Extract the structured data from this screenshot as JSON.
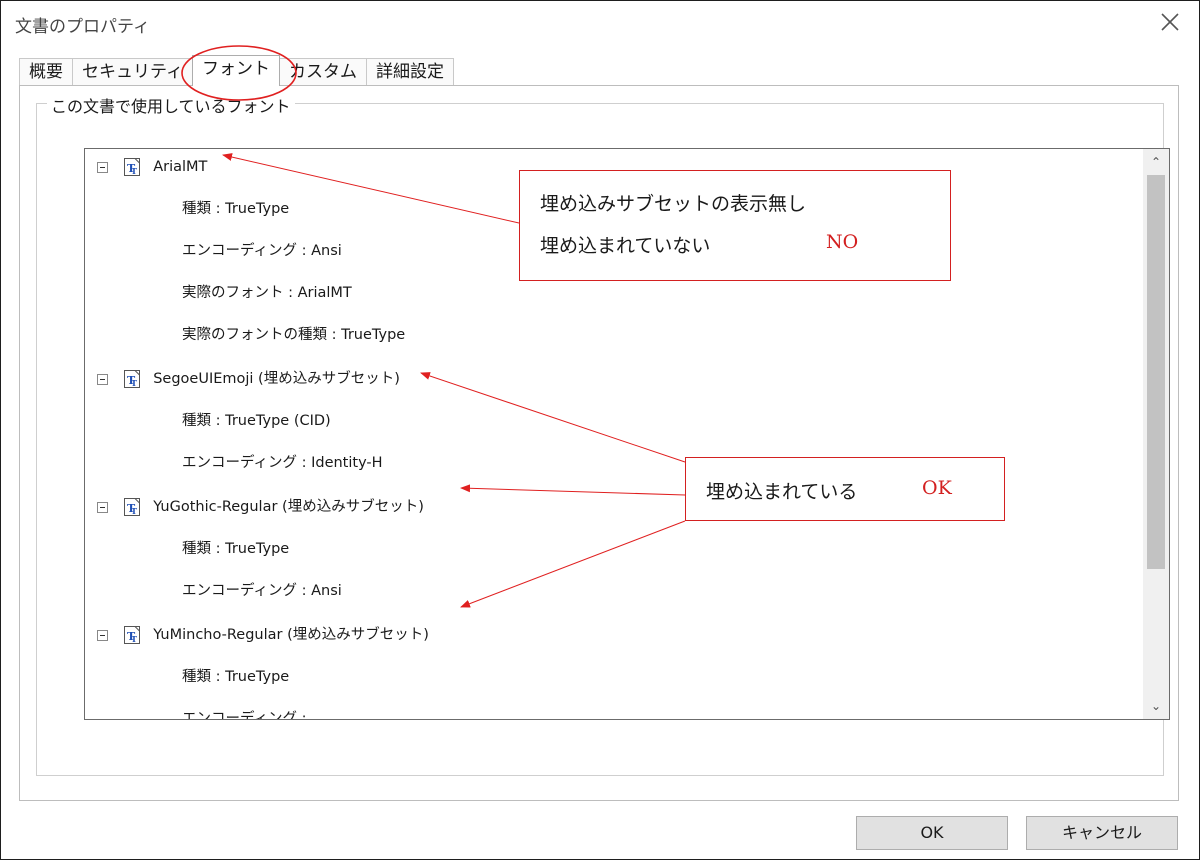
{
  "window": {
    "title": "文書のプロパティ"
  },
  "tabs": [
    {
      "label": "概要"
    },
    {
      "label": "セキュリティ"
    },
    {
      "label": "フォント"
    },
    {
      "label": "カスタム"
    },
    {
      "label": "詳細設定"
    }
  ],
  "active_tab": "フォント",
  "group": {
    "label": "この文書で使用しているフォント"
  },
  "fonts": [
    {
      "name": "ArialMT",
      "properties": [
        "種類 : TrueType",
        "エンコーディング : Ansi",
        "実際のフォント : ArialMT",
        "実際のフォントの種類 : TrueType"
      ]
    },
    {
      "name": "SegoeUIEmoji (埋め込みサブセット)",
      "properties": [
        "種類 : TrueType (CID)",
        "エンコーディング : Identity-H"
      ]
    },
    {
      "name": "YuGothic-Regular (埋め込みサブセット)",
      "properties": [
        "種類 : TrueType",
        "エンコーディング : Ansi"
      ]
    },
    {
      "name": "YuMincho-Regular (埋め込みサブセット)",
      "properties": [
        "種類 : TrueType",
        "エンコーディング : "
      ]
    }
  ],
  "annotations": {
    "callout_not_embedded": {
      "line1": "埋め込みサブセットの表示無し",
      "line2": "埋め込まれていない",
      "verdict": "NO"
    },
    "callout_embedded": {
      "line1": "埋め込まれている",
      "verdict": "OK"
    },
    "accent_color": "#d32020"
  },
  "buttons": {
    "ok": "OK",
    "cancel": "キャンセル"
  },
  "icons": {
    "close": "close-icon",
    "font": "truetype-font-icon",
    "toggle": "collapse-toggle-icon"
  }
}
